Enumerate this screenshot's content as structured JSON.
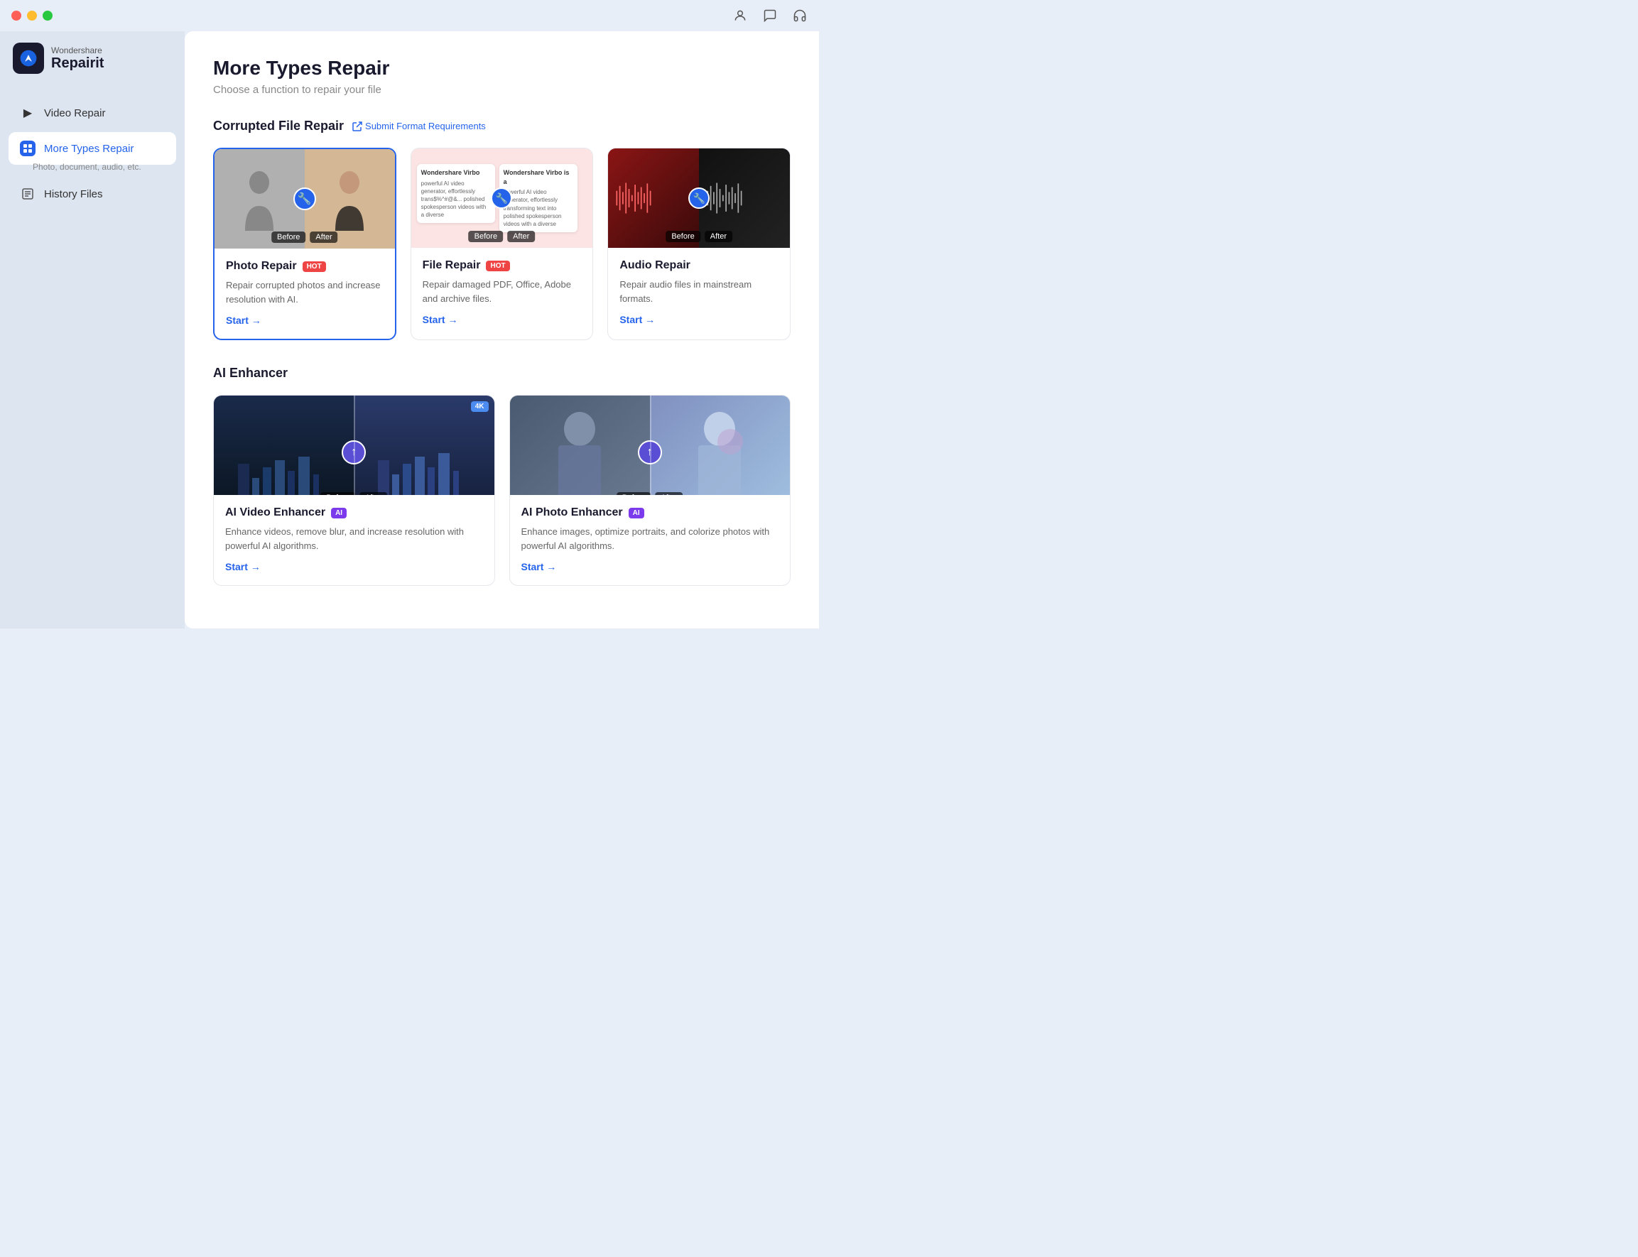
{
  "app": {
    "brand": "Wondershare",
    "product": "Repairit"
  },
  "titlebar": {
    "icons": [
      "person",
      "chat",
      "headset"
    ]
  },
  "sidebar": {
    "items": [
      {
        "id": "video-repair",
        "label": "Video Repair",
        "icon": "▶",
        "active": false
      },
      {
        "id": "more-types-repair",
        "label": "More Types Repair",
        "sublabel": "Photo, document, audio, etc.",
        "icon": "◆",
        "active": true
      },
      {
        "id": "history-files",
        "label": "History Files",
        "icon": "≡",
        "active": false
      }
    ]
  },
  "main": {
    "title": "More Types Repair",
    "subtitle": "Choose a function to repair your file",
    "sections": [
      {
        "id": "corrupted-file-repair",
        "title": "Corrupted File Repair",
        "link_label": "Submit Format Requirements",
        "cards": [
          {
            "id": "photo-repair",
            "title": "Photo Repair",
            "badge": "HOT",
            "badge_type": "hot",
            "description": "Repair corrupted photos and increase resolution with AI.",
            "start_label": "Start →",
            "selected": true
          },
          {
            "id": "file-repair",
            "title": "File Repair",
            "badge": "HOT",
            "badge_type": "hot",
            "description": "Repair damaged PDF, Office, Adobe and archive files.",
            "start_label": "Start →",
            "selected": false
          },
          {
            "id": "audio-repair",
            "title": "Audio Repair",
            "badge": null,
            "description": "Repair audio files in mainstream formats.",
            "start_label": "Start →",
            "selected": false
          }
        ]
      },
      {
        "id": "ai-enhancer",
        "title": "AI Enhancer",
        "cards": [
          {
            "id": "ai-video-enhancer",
            "title": "AI Video Enhancer",
            "badge": "AI",
            "badge_type": "ai",
            "description": "Enhance videos, remove blur, and increase resolution with powerful AI algorithms.",
            "start_label": "Start →",
            "four_k": "4K"
          },
          {
            "id": "ai-photo-enhancer",
            "title": "AI Photo Enhancer",
            "badge": "AI",
            "badge_type": "ai",
            "description": "Enhance images, optimize portraits, and colorize photos with powerful AI algorithms.",
            "start_label": "Start →"
          }
        ]
      }
    ]
  }
}
